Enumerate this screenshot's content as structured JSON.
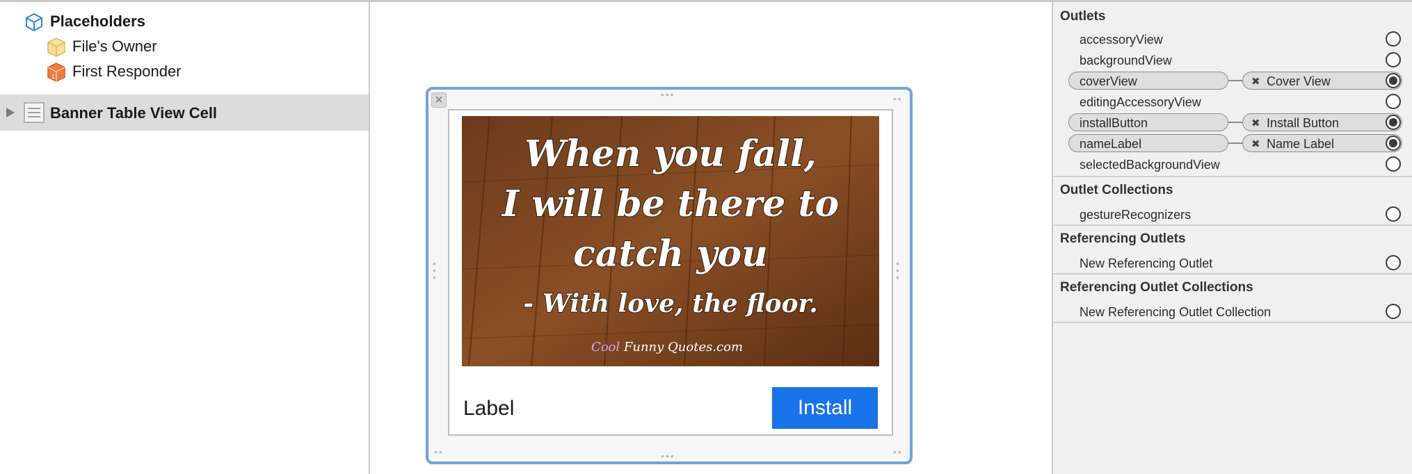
{
  "outline": {
    "placeholders_label": "Placeholders",
    "files_owner_label": "File's Owner",
    "first_responder_label": "First Responder",
    "cell_label": "Banner Table View Cell"
  },
  "canvas": {
    "cover_image": {
      "line1": "When you fall,",
      "line2": "I will be there to",
      "line3": "catch you",
      "line4": "- With love, the floor.",
      "watermark_cool": "Cool",
      "watermark_rest": " Funny Quotes.com"
    },
    "name_label": "Label",
    "install_button": "Install",
    "close_glyph": "×"
  },
  "inspector": {
    "outlets_title": "Outlets",
    "outlets": [
      {
        "name": "accessoryView",
        "target": ""
      },
      {
        "name": "backgroundView",
        "target": ""
      },
      {
        "name": "coverView",
        "target": "Cover View"
      },
      {
        "name": "editingAccessoryView",
        "target": ""
      },
      {
        "name": "installButton",
        "target": "Install Button"
      },
      {
        "name": "nameLabel",
        "target": "Name Label"
      },
      {
        "name": "selectedBackgroundView",
        "target": ""
      }
    ],
    "outlet_collections_title": "Outlet Collections",
    "gesture_recognizers": "gestureRecognizers",
    "referencing_outlets_title": "Referencing Outlets",
    "new_referencing_outlet": "New Referencing Outlet",
    "referencing_outlet_collections_title": "Referencing Outlet Collections",
    "new_referencing_outlet_collection": "New Referencing Outlet Collection",
    "disconnect_glyph": "✖"
  },
  "colors": {
    "accent": "#1a73e8",
    "selection_border": "#6fa4d8",
    "row_selected": "#dcdcdc",
    "inspector_bg": "#f0f0f0"
  },
  "icons": [
    "placeholder-cube-icon",
    "files-owner-cube-icon",
    "first-responder-cube-icon",
    "disclosure-triangle-icon",
    "table-view-cell-icon",
    "close-icon",
    "disconnect-icon",
    "connection-circle-icon"
  ]
}
